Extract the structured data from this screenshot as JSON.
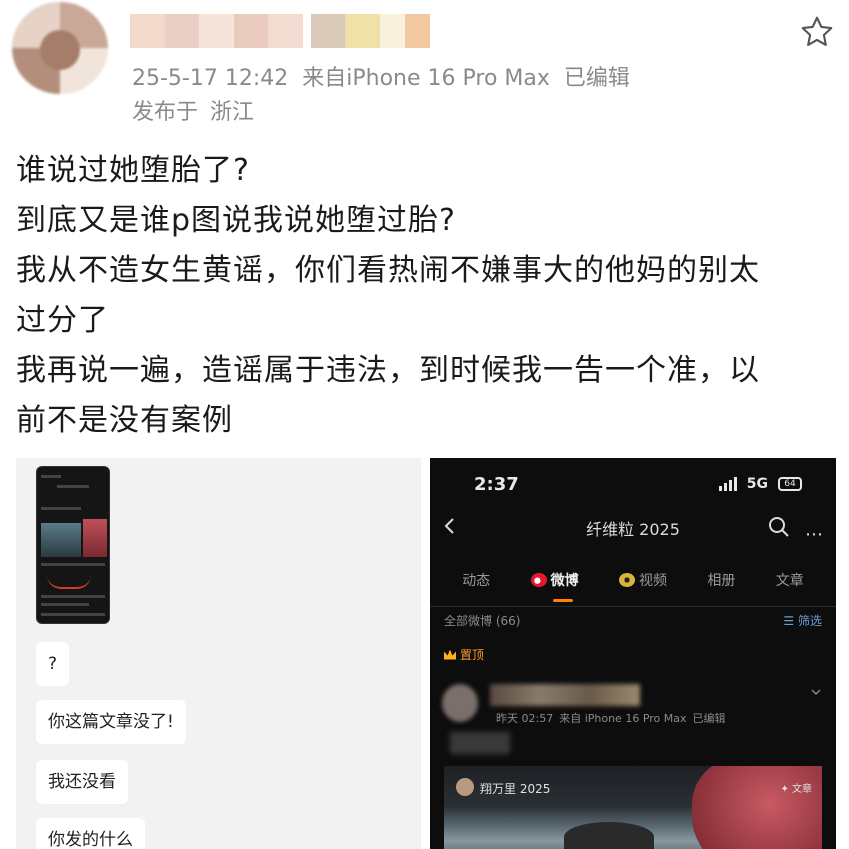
{
  "post": {
    "timestamp": "25-5-17 12:42",
    "source": "来自iPhone 16 Pro Max",
    "edited": "已编辑",
    "location_label": "发布于",
    "location": "浙江",
    "lines": [
      "谁说过她堕胎了?",
      "到底又是谁p图说我说她堕过胎?",
      "我从不造女生黄谣，你们看热闹不嫌事大的他妈的别太",
      "过分了",
      "我再说一遍，造谣属于违法，到时候我一告一个准，以",
      "前不是没有案例"
    ]
  },
  "chat": {
    "bubbles": [
      "?",
      "你这篇文章没了!",
      "我还没看",
      "你发的什么"
    ]
  },
  "profile_screenshot": {
    "time": "2:37",
    "network": "5G",
    "battery": "64",
    "title": "纤维粒 2025",
    "more": "⋯",
    "tabs": [
      "动态",
      "微博",
      "视频",
      "相册",
      "文章"
    ],
    "filter_label": "全部微博 (66)",
    "filter_action": "筛选",
    "pinned": "置顶",
    "post_time": "昨天 02:57",
    "post_source": "来自 iPhone 16 Pro Max",
    "post_edited": "已编辑",
    "card_name": "翔万里 2025",
    "card_tag": "文章"
  },
  "colors": {
    "meta_text": "#8a8a8a",
    "accent_orange": "#ff8200",
    "dark_bg": "#0d0d0d"
  }
}
